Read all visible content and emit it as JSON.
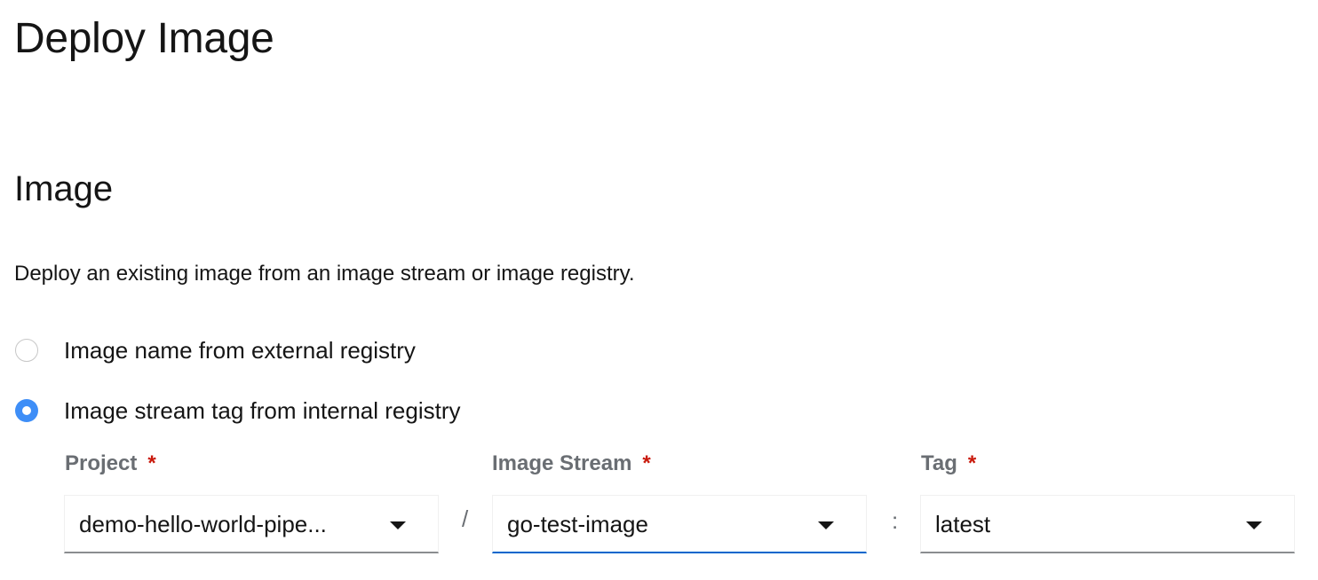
{
  "page": {
    "title": "Deploy Image"
  },
  "section": {
    "title": "Image",
    "description": "Deploy an existing image from an image stream or image registry."
  },
  "radios": [
    {
      "label": "Image name from external registry",
      "checked": false
    },
    {
      "label": "Image stream tag from internal registry",
      "checked": true
    }
  ],
  "fields": {
    "project": {
      "label": "Project",
      "required_mark": "*",
      "value": "demo-hello-world-pipe..."
    },
    "image_stream": {
      "label": "Image Stream",
      "required_mark": "*",
      "value": "go-test-image"
    },
    "tag": {
      "label": "Tag",
      "required_mark": "*",
      "value": "latest"
    }
  },
  "separators": {
    "slash": "/",
    "colon": ":"
  },
  "colors": {
    "accent": "#3e8ef7",
    "focus": "#0066cc",
    "required": "#c9190b",
    "label": "#6a6e73"
  },
  "icons": {
    "dropdown": "caret-down-icon"
  }
}
